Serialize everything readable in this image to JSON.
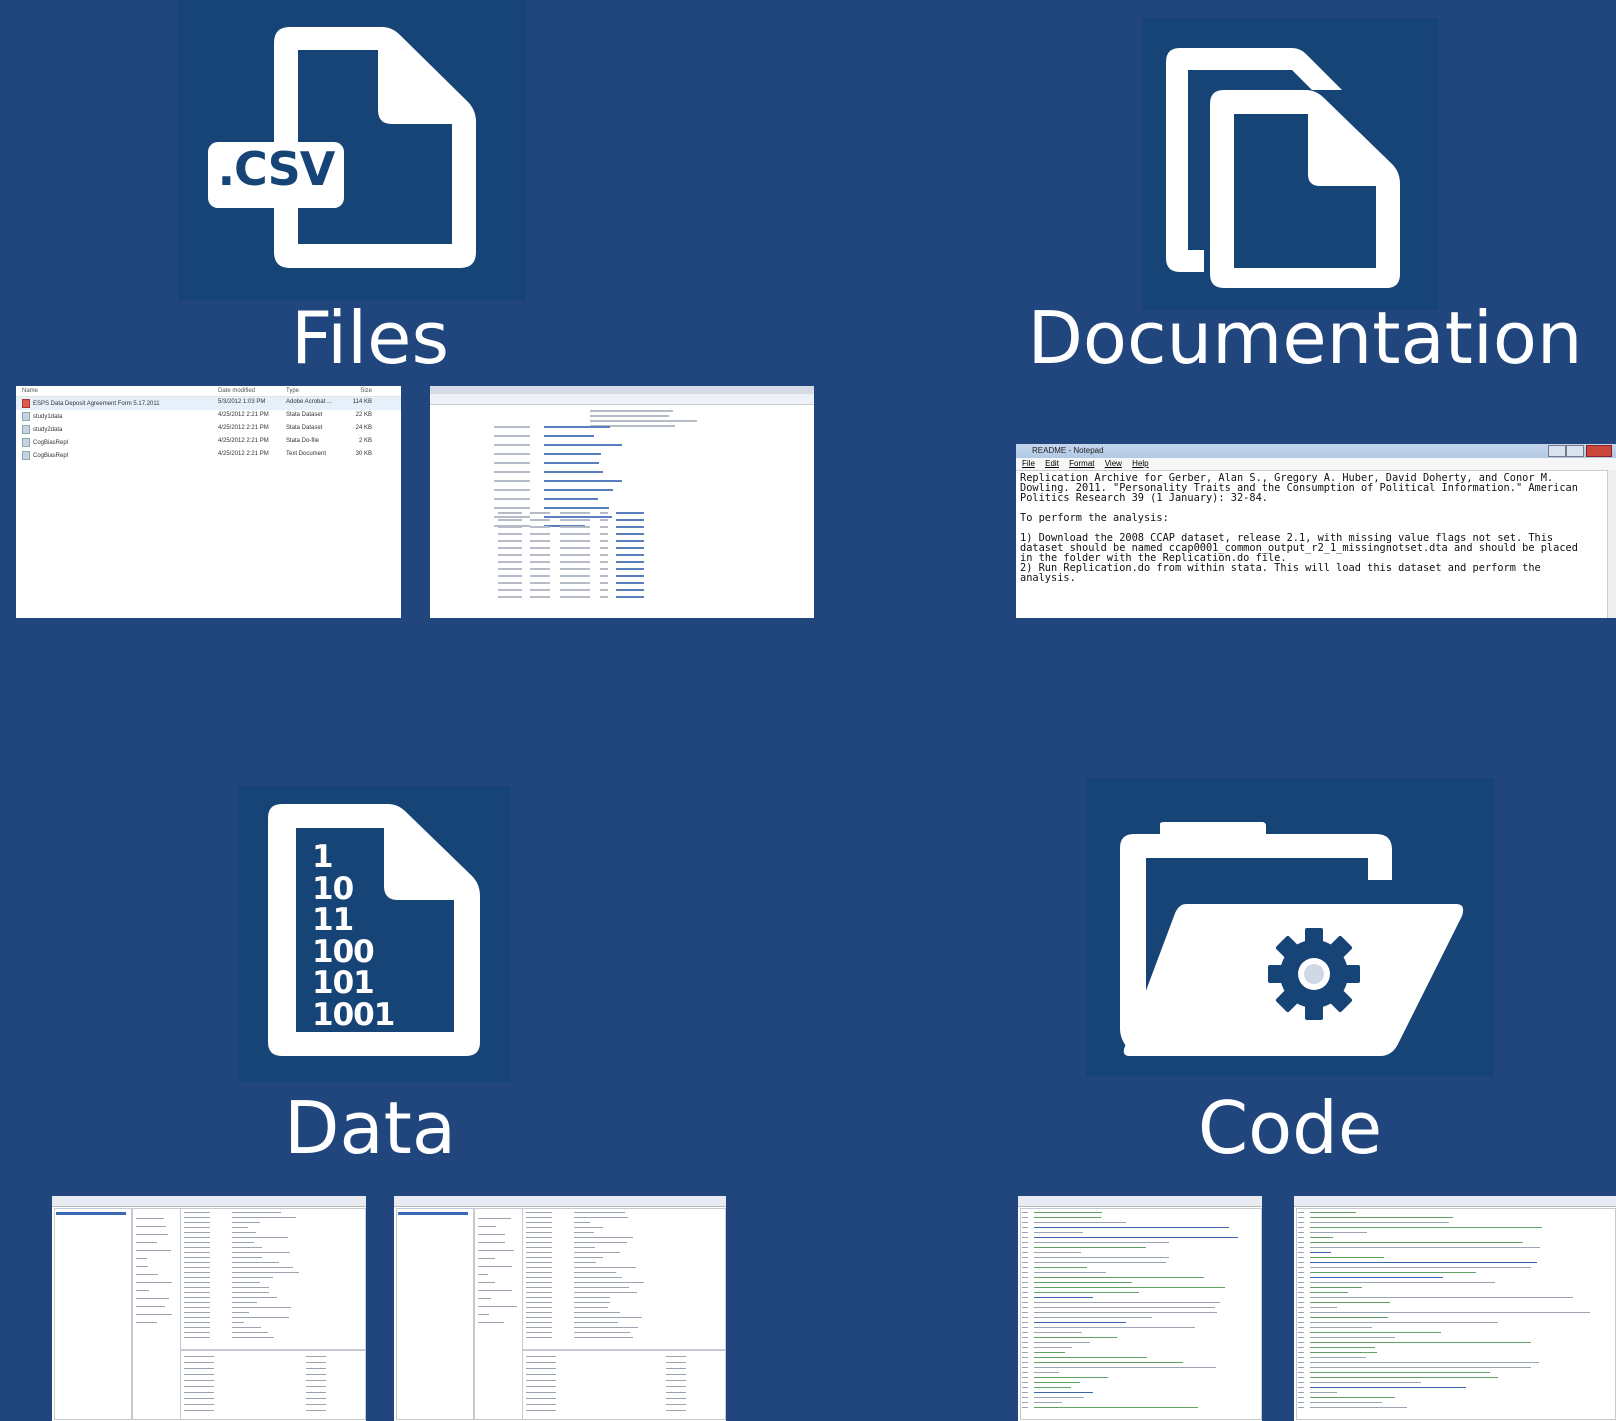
{
  "colors": {
    "background": "#21467d",
    "tile": "#174477",
    "icon": "#ffffff"
  },
  "sections": {
    "files": {
      "title": "Files",
      "icon": "csv-file-icon",
      "icon_badge": ".CSV",
      "explorer": {
        "columns": [
          "Name",
          "Date modified",
          "Type",
          "Size"
        ],
        "rows": [
          [
            "ESPS Data Deposit Agreement Form 5.17.2011",
            "5/3/2012 1:03 PM",
            "Adobe Acrobat ...",
            "114 KB"
          ],
          [
            "study1data",
            "4/25/2012 2:21 PM",
            "Stata Dataset",
            "22 KB"
          ],
          [
            "study2data",
            "4/25/2012 2:21 PM",
            "Stata Dataset",
            "24 KB"
          ],
          [
            "CogBiasRepl",
            "4/25/2012 2:21 PM",
            "Stata Do-file",
            "2 KB"
          ],
          [
            "CogBiasRepl",
            "4/25/2012 2:21 PM",
            "Text Document",
            "30 KB"
          ]
        ]
      }
    },
    "documentation": {
      "title": "Documentation",
      "icon": "documents-icon",
      "notepad": {
        "title": "README - Notepad",
        "menu": [
          "File",
          "Edit",
          "Format",
          "View",
          "Help"
        ],
        "text": "Replication Archive for Gerber, Alan S., Gregory A. Huber, David Doherty, and Conor M.\nDowling. 2011. \"Personality Traits and the Consumption of Political Information.\" American\nPolitics Research 39 (1 January): 32-84.\n\nTo perform the analysis:\n\n1) Download the 2008 CCAP dataset, release 2.1, with missing value flags not set. This\ndataset should be named ccap0001_common_output_r2_1_missingnotset.dta and should be placed\nin the folder with the Replication.do file.\n2) Run Replication.do from within stata. This will load this dataset and perform the\nanalysis."
      }
    },
    "data": {
      "title": "Data",
      "icon": "binary-data-file-icon",
      "binary_lines": [
        "1",
        "10",
        "11",
        "100",
        "101",
        "1001"
      ]
    },
    "code": {
      "title": "Code",
      "icon": "code-folder-gear-icon"
    }
  }
}
